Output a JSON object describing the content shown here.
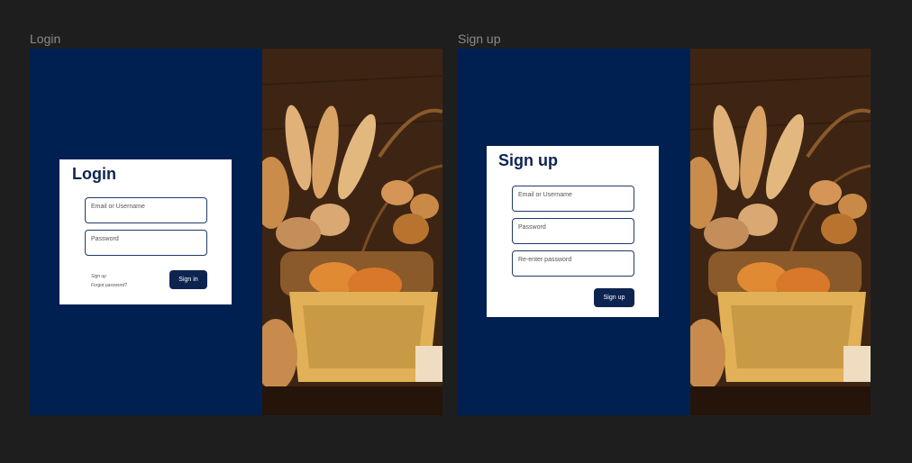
{
  "canvas": {
    "frames": [
      {
        "label": "Login"
      },
      {
        "label": "Sign up"
      }
    ]
  },
  "login": {
    "title": "Login",
    "email_placeholder": "Email or Username",
    "password_placeholder": "Password",
    "sign_up_link": "Sign up",
    "forgot_link": "Forgot password?",
    "submit_label": "Sign in"
  },
  "signup": {
    "title": "Sign up",
    "email_placeholder": "Email or Username",
    "password_placeholder": "Password",
    "reenter_placeholder": "Re-enter password",
    "submit_label": "Sign up"
  },
  "colors": {
    "canvas_bg": "#1e1e1e",
    "panel_navy": "#002051",
    "button": "#0e2450",
    "card": "#ffffff"
  },
  "images": {
    "hero": "bread-basket-photo"
  }
}
